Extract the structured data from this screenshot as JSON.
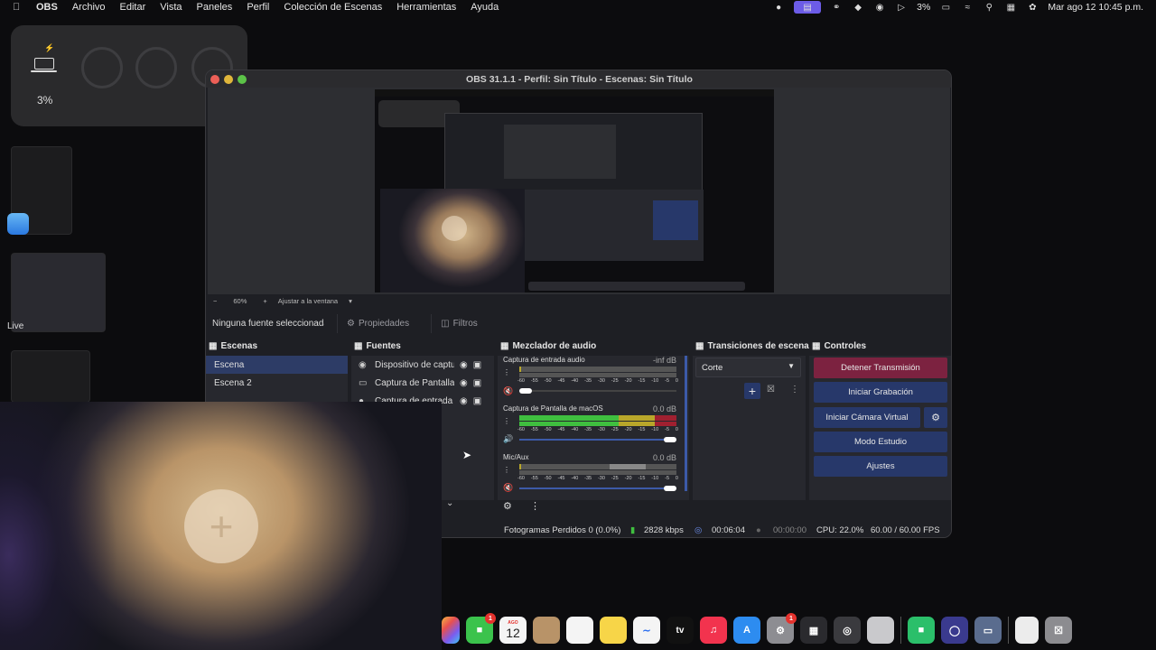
{
  "menubar": {
    "app_name": "OBS",
    "menus": [
      "Archivo",
      "Editar",
      "Vista",
      "Paneles",
      "Perfil",
      "Colección de Escenas",
      "Herramientas",
      "Ayuda"
    ],
    "battery_percent": "3%",
    "datetime": "Mar ago 12  10:45 p.m."
  },
  "battery_widget": {
    "percent": "3%"
  },
  "stage": {
    "live_label": "Live"
  },
  "obs": {
    "title": "OBS 31.1.1 - Perfil: Sin Título - Escenas: Sin Título",
    "zoom": "60%",
    "fit_label": "Ajustar a la ventana",
    "no_source": "Ninguna fuente seleccionada",
    "properties_label": "Propiedades",
    "filters_label": "Filtros",
    "scenes": {
      "title": "Escenas",
      "items": [
        "Escena",
        "Escena 2"
      ]
    },
    "sources": {
      "title": "Fuentes",
      "items": [
        "Dispositivo de captura",
        "Captura de Pantalla de macOS",
        "Captura de entrada audio"
      ]
    },
    "mixer": {
      "title": "Mezclador de audio",
      "scale": [
        "-60",
        "-55",
        "-50",
        "-45",
        "-40",
        "-35",
        "-30",
        "-25",
        "-20",
        "-15",
        "-10",
        "-5",
        "0"
      ],
      "channels": [
        {
          "name": "Captura de entrada audio",
          "db": "-inf dB"
        },
        {
          "name": "Captura de Pantalla de macOS",
          "db": "0.0 dB"
        },
        {
          "name": "Mic/Aux",
          "db": "0.0 dB"
        }
      ]
    },
    "transitions": {
      "title": "Transiciones de escena",
      "selected": "Corte"
    },
    "controls": {
      "title": "Controles",
      "stop_stream": "Detener Transmisión",
      "start_record": "Iniciar Grabación",
      "start_vcam": "Iniciar Cámara Virtual",
      "studio_mode": "Modo Estudio",
      "settings": "Ajustes"
    },
    "status": {
      "dropped": "Fotogramas Perdidos 0 (0.0%)",
      "bitrate": "2828 kbps",
      "stream_time": "00:06:04",
      "rec_time": "00:00:00",
      "cpu": "CPU: 22.0%",
      "fps": "60.00 / 60.00 FPS"
    }
  },
  "dock": {
    "calendar_month": "AGO",
    "calendar_day": "12",
    "facetime_badge": "1",
    "settings_badge": "1",
    "tv_label": "tv"
  },
  "colors": {
    "accent": "#27386a",
    "danger": "#7c2240",
    "meter_green": "#3fbf3f",
    "meter_yellow": "#b8a62a",
    "meter_red": "#a02030"
  }
}
